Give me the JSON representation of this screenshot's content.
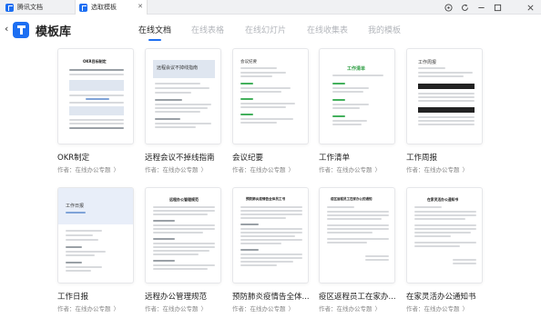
{
  "window": {
    "tabs": [
      {
        "label": "腾讯文档"
      },
      {
        "label": "选取模板"
      }
    ],
    "controls": [
      "target-icon",
      "refresh-icon",
      "minimize-icon",
      "close-icon"
    ]
  },
  "header": {
    "back_glyph": "‹",
    "title": "模板库",
    "tabs": [
      {
        "label": "在线文档",
        "active": true
      },
      {
        "label": "在线表格",
        "active": false
      },
      {
        "label": "在线幻灯片",
        "active": false
      },
      {
        "label": "在线收集表",
        "active": false
      },
      {
        "label": "我的模板",
        "active": false
      }
    ]
  },
  "cards": [
    {
      "title": "OKR制定",
      "author": "作者：在线办公专题",
      "chevron": "〉",
      "thumb_heading": "OKR目标制定"
    },
    {
      "title": "远程会议不掉线指南",
      "author": "作者：在线办公专题",
      "chevron": "〉",
      "thumb_heading": "远程会议不掉线指南"
    },
    {
      "title": "会议纪要",
      "author": "作者：在线办公专题",
      "chevron": "〉",
      "thumb_heading": "会议纪要"
    },
    {
      "title": "工作清单",
      "author": "作者：在线办公专题",
      "chevron": "〉",
      "thumb_heading": "工作清单"
    },
    {
      "title": "工作周报",
      "author": "作者：在线办公专题",
      "chevron": "〉",
      "thumb_heading": "工作周报"
    },
    {
      "title": "工作日报",
      "author": "作者：在线办公专题",
      "chevron": "〉",
      "thumb_heading": "工作日报"
    },
    {
      "title": "远程办公管理规范",
      "author": "作者：在线办公专题",
      "chevron": "〉",
      "thumb_heading": "远程办公管理规范"
    },
    {
      "title": "预防肺炎疫情告全体...",
      "author": "作者：在线办公专题",
      "chevron": "〉",
      "thumb_heading": "预防肺炎疫情告全体员工书"
    },
    {
      "title": "疫区返程员工在家办...",
      "author": "作者：在线办公专题",
      "chevron": "〉",
      "thumb_heading": "疫区返程员工在家办公的通知"
    },
    {
      "title": "在家灵活办公通知书",
      "author": "作者：在线办公专题",
      "chevron": "〉",
      "thumb_heading": "在家灵活办公通知书"
    }
  ],
  "colors": {
    "accent": "#1d6ff2",
    "inactive_tab": "#b3b6bb",
    "author_text": "#888888"
  }
}
